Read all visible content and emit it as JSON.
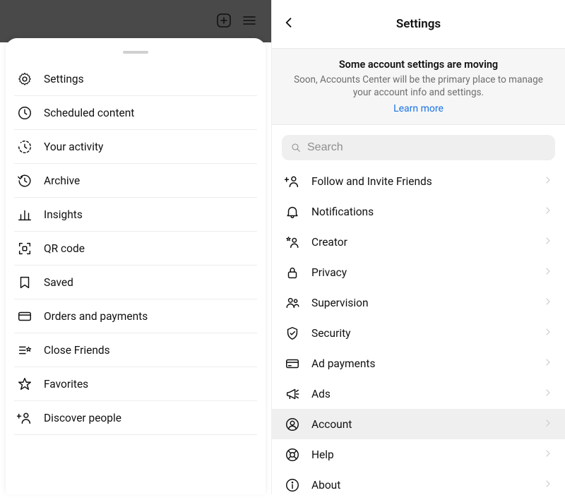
{
  "left": {
    "menu": [
      {
        "label": "Settings"
      },
      {
        "label": "Scheduled content"
      },
      {
        "label": "Your activity"
      },
      {
        "label": "Archive"
      },
      {
        "label": "Insights"
      },
      {
        "label": "QR code"
      },
      {
        "label": "Saved"
      },
      {
        "label": "Orders and payments"
      },
      {
        "label": "Close Friends"
      },
      {
        "label": "Favorites"
      },
      {
        "label": "Discover people"
      }
    ]
  },
  "right": {
    "title": "Settings",
    "banner": {
      "title": "Some account settings are moving",
      "body": "Soon, Accounts Center will be the primary place to manage your account info and settings.",
      "link": "Learn more"
    },
    "search_placeholder": "Search",
    "items": [
      {
        "label": "Follow and Invite Friends"
      },
      {
        "label": "Notifications"
      },
      {
        "label": "Creator"
      },
      {
        "label": "Privacy"
      },
      {
        "label": "Supervision"
      },
      {
        "label": "Security"
      },
      {
        "label": "Ad payments"
      },
      {
        "label": "Ads"
      },
      {
        "label": "Account"
      },
      {
        "label": "Help"
      },
      {
        "label": "About"
      }
    ]
  }
}
